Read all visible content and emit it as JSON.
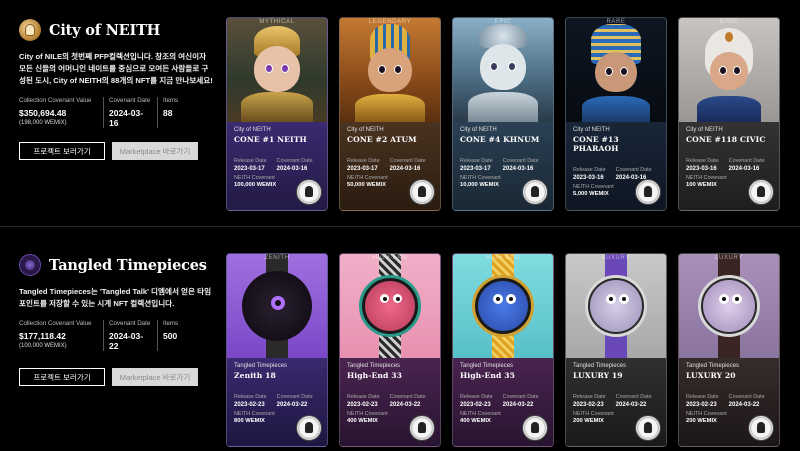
{
  "sections": [
    {
      "title": "City of NEITH",
      "description": "City of NILE의 첫번째 PFP컬렉션입니다. 창조의 여신이자 모든 신들의 어머니인 네이트를 중심으로 모여든 사람들로 구성된 도시, City of NEITH의 88개의 NFT를 지금 만나보세요!",
      "stats": {
        "covenant_value_label": "Collection Covenant Value",
        "covenant_value": "$350,694.48",
        "covenant_value_sub": "(198,000 WEMIX)",
        "covenant_date_label": "Covenant Date",
        "covenant_date": "2024-03-16",
        "items_label": "Items",
        "items": "88"
      },
      "buttons": {
        "project": "프로젝트 보러가기",
        "marketplace": "Marketplace 바로가기"
      },
      "cards": [
        {
          "tier": "MYTHICAL",
          "collection": "City of NEITH",
          "name": "CONE #1 NEITH",
          "release_label": "Release Date",
          "release": "2023-03-17",
          "covenant_label": "Covenant Date",
          "covenant": "2024-03-16",
          "neith_label": "NEITH Covenant",
          "neith": "100,000 WEMIX",
          "bg": "#3a2a63"
        },
        {
          "tier": "LEGENDARY",
          "collection": "City of NEITH",
          "name": "CONE #2 ATUM",
          "release_label": "Release Date",
          "release": "2023-03-17",
          "covenant_label": "Covenant Date",
          "covenant": "2024-03-16",
          "neith_label": "NEITH Covenant",
          "neith": "50,000 WEMIX",
          "bg": "#4a3320"
        },
        {
          "tier": "EPIC",
          "collection": "City of NEITH",
          "name": "CONE #4 KHNUM",
          "release_label": "Release Date",
          "release": "2023-03-17",
          "covenant_label": "Covenant Date",
          "covenant": "2024-03-16",
          "neith_label": "NEITH Covenant",
          "neith": "10,000 WEMIX",
          "bg": "#25384a"
        },
        {
          "tier": "RARE",
          "collection": "City of NEITH",
          "name": "CONE #13 PHARAOH",
          "release_label": "Release Date",
          "release": "2023-03-16",
          "covenant_label": "Covenant Date",
          "covenant": "2024-03-16",
          "neith_label": "NEITH Covenant",
          "neith": "5,000 WEMIX",
          "bg": "#1c2a3e"
        },
        {
          "tier": "CIVIC",
          "collection": "City of NEITH",
          "name": "CONE #118 CIVIC",
          "release_label": "Release Date",
          "release": "2023-03-16",
          "covenant_label": "Covenant Date",
          "covenant": "2024-03-16",
          "neith_label": "NEITH Covenant",
          "neith": "100 WEMIX",
          "bg": "#3a3a3a"
        }
      ]
    },
    {
      "title": "Tangled Timepieces",
      "description": "Tangled Timepieces는 'Tangled Talk' 디엠에서 얻은 타임포인트를 저장할 수 있는 시계 NFT 컬렉션입니다.",
      "stats": {
        "covenant_value_label": "Collection Covenant Value",
        "covenant_value": "$177,118.42",
        "covenant_value_sub": "(100,000 WEMIX)",
        "covenant_date_label": "Covenant Date",
        "covenant_date": "2024-03-22",
        "items_label": "Items",
        "items": "500"
      },
      "buttons": {
        "project": "프로젝트 보러가기",
        "marketplace": "Marketplace 바로가기"
      },
      "cards": [
        {
          "tier": "ZENITH",
          "collection": "Tangled Timepieces",
          "name": "Zenith 18",
          "release_label": "Release Date",
          "release": "2023-02-23",
          "covenant_label": "Covenant Date",
          "covenant": "2024-03-22",
          "neith_label": "NEITH Covenant",
          "neith": "800 WEMIX",
          "bg": "#3a2a6a"
        },
        {
          "tier": "HIGH-END",
          "collection": "Tangled Timepieces",
          "name": "High-End 33",
          "release_label": "Release Date",
          "release": "2023-02-23",
          "covenant_label": "Covenant Date",
          "covenant": "2024-03-22",
          "neith_label": "NEITH Covenant",
          "neith": "400 WEMIX",
          "bg": "#4a2a55"
        },
        {
          "tier": "HIGH-END",
          "collection": "Tangled Timepieces",
          "name": "High-End 35",
          "release_label": "Release Date",
          "release": "2023-02-23",
          "covenant_label": "Covenant Date",
          "covenant": "2024-03-22",
          "neith_label": "NEITH Covenant",
          "neith": "400 WEMIX",
          "bg": "#4a2a55"
        },
        {
          "tier": "LUXURY",
          "collection": "Tangled Timepieces",
          "name": "LUXURY 19",
          "release_label": "Release Date",
          "release": "2023-02-23",
          "covenant_label": "Covenant Date",
          "covenant": "2024-03-22",
          "neith_label": "NEITH Covenant",
          "neith": "200 WEMIX",
          "bg": "#333333"
        },
        {
          "tier": "LUXURY",
          "collection": "Tangled Timepieces",
          "name": "LUXURY 20",
          "release_label": "Release Date",
          "release": "2023-02-23",
          "covenant_label": "Covenant Date",
          "covenant": "2024-03-22",
          "neith_label": "NEITH Covenant",
          "neith": "200 WEMIX",
          "bg": "#3a3434"
        }
      ]
    }
  ]
}
